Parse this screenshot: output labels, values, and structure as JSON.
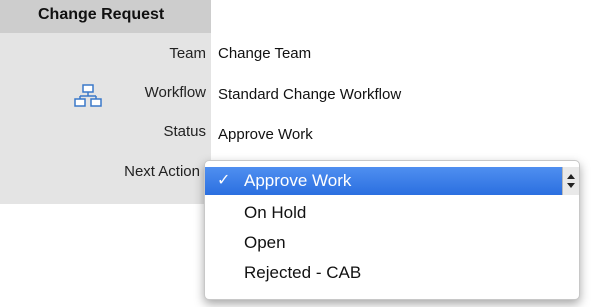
{
  "section": {
    "title": "Change Request"
  },
  "fields": {
    "team": {
      "label": "Team",
      "value": "Change Team"
    },
    "workflow": {
      "label": "Workflow",
      "value": "Standard Change Workflow",
      "icon": "workflow-hierarchy-icon"
    },
    "status": {
      "label": "Status",
      "value": "Approve Work"
    },
    "next_action": {
      "label": "Next Action"
    }
  },
  "dropdown": {
    "selected": "Approve Work",
    "check": "✓",
    "options": [
      "Approve Work",
      "On Hold",
      "Open",
      "Rejected - CAB"
    ]
  },
  "colors": {
    "header_bg": "#cdcdcd",
    "label_bg": "#e4e4e4",
    "selection": "#3b7ee8",
    "icon": "#3a78c9"
  }
}
